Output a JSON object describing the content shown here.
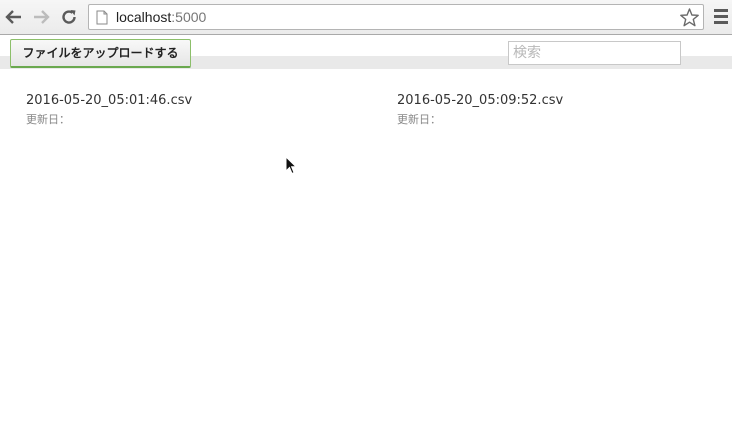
{
  "browser": {
    "url_host": "localhost",
    "url_port": ":5000"
  },
  "header": {
    "upload_label": "ファイルをアップロードする",
    "search_placeholder": "検索"
  },
  "files": [
    {
      "name": "2016-05-20_05:01:46.csv",
      "updated_label": "更新日："
    },
    {
      "name": "2016-05-20_05:09:52.csv",
      "updated_label": "更新日："
    }
  ]
}
